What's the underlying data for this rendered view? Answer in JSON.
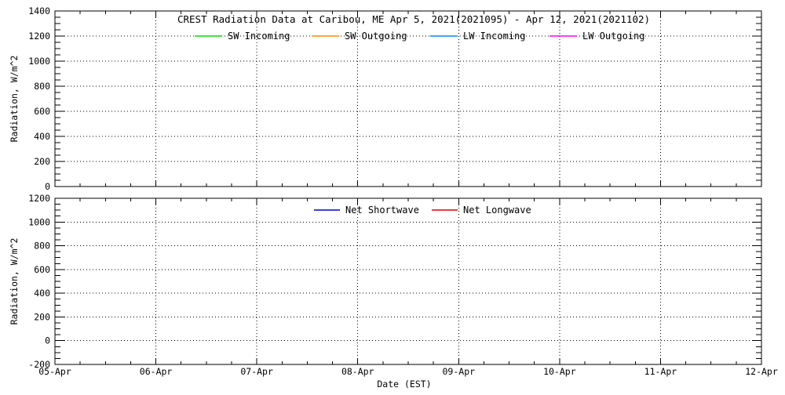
{
  "figure": {
    "background": "#ffffff",
    "foreground": "#000000"
  },
  "chart_data": [
    {
      "type": "line",
      "panel": "radiation-components",
      "title": "CREST Radiation Data at Caribou, ME   Apr  5, 2021(2021095) - Apr 12, 2021(2021102)",
      "ylabel": "Radiation, W/m^2",
      "ylim": [
        0,
        1400
      ],
      "ytick_interval": 200,
      "yminor_interval": 50,
      "ytick_labels": [
        "0",
        "200",
        "400",
        "600",
        "800",
        "1000",
        "1200",
        "1400"
      ],
      "x": [
        "05-Apr",
        "06-Apr",
        "07-Apr",
        "08-Apr",
        "09-Apr",
        "10-Apr",
        "11-Apr",
        "12-Apr"
      ],
      "xminor_per_day": 4,
      "grid": "dotted",
      "legend_position": "top-inside",
      "series": [
        {
          "name": "SW Incoming",
          "color": "#00dd00",
          "values": []
        },
        {
          "name": "SW Outgoing",
          "color": "#ff8800",
          "values": []
        },
        {
          "name": "LW Incoming",
          "color": "#0088ff",
          "values": []
        },
        {
          "name": "LW Outgoing",
          "color": "#ff00ff",
          "values": []
        }
      ]
    },
    {
      "type": "line",
      "panel": "net-radiation",
      "ylabel": "Radiation, W/m^2",
      "xlabel": "Date (EST)",
      "ylim": [
        -200,
        1200
      ],
      "ytick_interval": 200,
      "yminor_interval": 50,
      "ytick_labels": [
        "-200",
        "0",
        "200",
        "400",
        "600",
        "800",
        "1000",
        "1200"
      ],
      "x": [
        "05-Apr",
        "06-Apr",
        "07-Apr",
        "08-Apr",
        "09-Apr",
        "10-Apr",
        "11-Apr",
        "12-Apr"
      ],
      "xminor_per_day": 4,
      "grid": "dotted",
      "legend_position": "top-inside",
      "series": [
        {
          "name": "Net Shortwave",
          "color": "#0000cc",
          "values": []
        },
        {
          "name": "Net Longwave",
          "color": "#dd0000",
          "values": []
        }
      ]
    }
  ]
}
